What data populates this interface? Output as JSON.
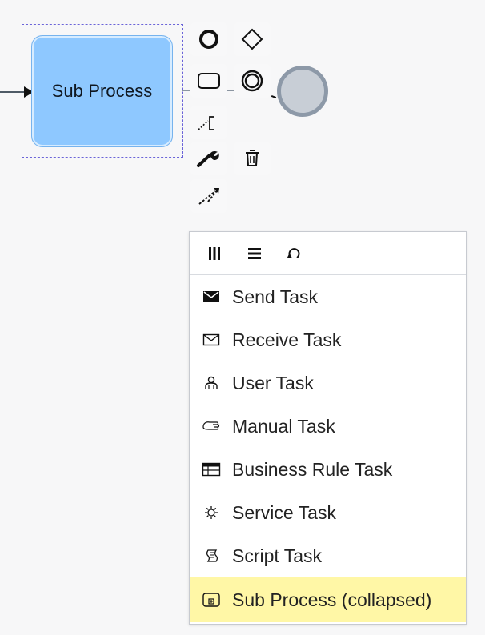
{
  "diagram": {
    "subprocess_label": "Sub Process"
  },
  "context_pad": {
    "items": [
      {
        "id": "start-event",
        "icon": "circle-outline-icon"
      },
      {
        "id": "gateway",
        "icon": "diamond-icon"
      },
      {
        "id": "task",
        "icon": "rounded-rect-icon"
      },
      {
        "id": "intermediate-event",
        "icon": "double-circle-icon"
      },
      {
        "id": "text-annotation",
        "icon": "annotation-icon"
      },
      {
        "id": "change-type",
        "icon": "wrench-icon"
      },
      {
        "id": "delete",
        "icon": "trash-icon"
      },
      {
        "id": "connect",
        "icon": "connect-arrow-icon"
      }
    ]
  },
  "replace_menu": {
    "header_icons": [
      {
        "name": "parallel-multi-instance-icon"
      },
      {
        "name": "sequential-multi-instance-icon"
      },
      {
        "name": "loop-icon"
      }
    ],
    "items": [
      {
        "label": "Send Task",
        "icon": "send-task-icon"
      },
      {
        "label": "Receive Task",
        "icon": "receive-task-icon"
      },
      {
        "label": "User Task",
        "icon": "user-task-icon"
      },
      {
        "label": "Manual Task",
        "icon": "manual-task-icon"
      },
      {
        "label": "Business Rule Task",
        "icon": "business-rule-task-icon"
      },
      {
        "label": "Service Task",
        "icon": "service-task-icon"
      },
      {
        "label": "Script Task",
        "icon": "script-task-icon"
      },
      {
        "label": "Sub Process (collapsed)",
        "icon": "subprocess-collapsed-icon"
      }
    ],
    "selected_item": "Sub Process (collapsed)"
  },
  "colors": {
    "subprocess_fill": "#8ec8ff",
    "selection_outline": "#6a63d8",
    "selected_menu_item": "#fff7a6",
    "end_event_fill": "#c8ced6",
    "end_event_stroke": "#8d99a8"
  }
}
